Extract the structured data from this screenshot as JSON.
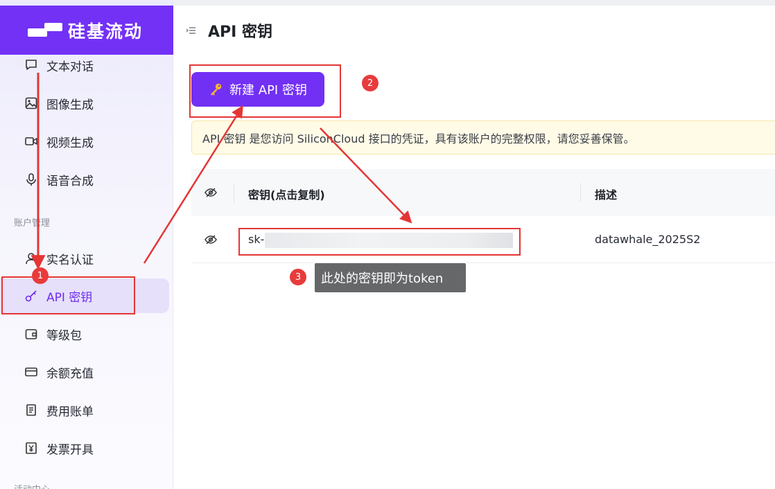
{
  "brand": {
    "name": "硅基流动"
  },
  "sidebar": {
    "items_top": [
      {
        "label": "文本对话",
        "icon": "chat-icon"
      },
      {
        "label": "图像生成",
        "icon": "image-icon"
      },
      {
        "label": "视频生成",
        "icon": "video-icon"
      },
      {
        "label": "语音合成",
        "icon": "microphone-icon"
      }
    ],
    "section_account": "账户管理",
    "items_account": [
      {
        "label": "实名认证",
        "icon": "user-icon"
      },
      {
        "label": "API 密钥",
        "icon": "key-icon",
        "active": true
      },
      {
        "label": "等级包",
        "icon": "wallet-icon"
      },
      {
        "label": "余额充值",
        "icon": "card-icon"
      },
      {
        "label": "费用账单",
        "icon": "bill-icon"
      },
      {
        "label": "发票开具",
        "icon": "yen-icon"
      }
    ],
    "section_activity": "活动中心"
  },
  "main": {
    "title": "API 密钥",
    "new_button": "新建 API 密钥",
    "notice": "API 密钥 是您访问 SiliconCloud 接口的凭证，具有该账户的完整权限，请您妥善保管。",
    "table": {
      "headers": [
        "密钥(点击复制)",
        "描述"
      ],
      "rows": [
        {
          "key_prefix": "sk-",
          "description": "datawhale_2025S2"
        }
      ]
    }
  },
  "annotations": {
    "badges": [
      "1",
      "2",
      "3"
    ],
    "tooltip": "此处的密钥即为token",
    "color": "#e53535"
  },
  "colors": {
    "brand": "#7331f6",
    "active_bg": "#e6e0fb",
    "notice_bg": "#fffbe7"
  }
}
